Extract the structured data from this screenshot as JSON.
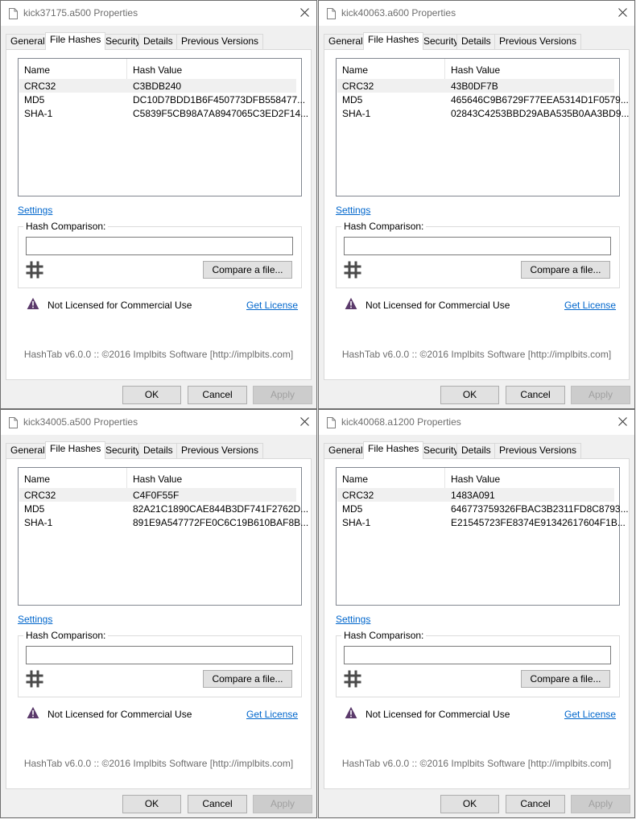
{
  "tabs": [
    "General",
    "File Hashes",
    "Security",
    "Details",
    "Previous Versions"
  ],
  "columns": {
    "name": "Name",
    "hash": "Hash Value"
  },
  "settings_link": "Settings",
  "hash_comparison_label": "Hash Comparison:",
  "hash_input_value": "",
  "compare_button": "Compare a file...",
  "license_warning": "Not Licensed for Commercial Use",
  "get_license_link": "Get License",
  "footer": "HashTab v6.0.0 :: ©2016 Implbits Software [http://implbits.com]",
  "buttons": {
    "ok": "OK",
    "cancel": "Cancel",
    "apply": "Apply"
  },
  "windows": [
    {
      "title": "kick37175.a500 Properties",
      "hashes": [
        {
          "name": "CRC32",
          "value": "C3BDB240"
        },
        {
          "name": "MD5",
          "value": "DC10D7BDD1B6F450773DFB558477..."
        },
        {
          "name": "SHA-1",
          "value": "C5839F5CB98A7A8947065C3ED2F14..."
        }
      ]
    },
    {
      "title": "kick40063.a600 Properties",
      "hashes": [
        {
          "name": "CRC32",
          "value": "43B0DF7B"
        },
        {
          "name": "MD5",
          "value": "465646C9B6729F77EEA5314D1F0579..."
        },
        {
          "name": "SHA-1",
          "value": "02843C4253BBD29ABA535B0AA3BD9..."
        }
      ]
    },
    {
      "title": "kick34005.a500 Properties",
      "hashes": [
        {
          "name": "CRC32",
          "value": "C4F0F55F"
        },
        {
          "name": "MD5",
          "value": "82A21C1890CAE844B3DF741F2762D..."
        },
        {
          "name": "SHA-1",
          "value": "891E9A547772FE0C6C19B610BAF8B..."
        }
      ]
    },
    {
      "title": "kick40068.a1200 Properties",
      "hashes": [
        {
          "name": "CRC32",
          "value": "1483A091"
        },
        {
          "name": "MD5",
          "value": "646773759326FBAC3B2311FD8C8793..."
        },
        {
          "name": "SHA-1",
          "value": "E21545723FE8374E91342617604F1B..."
        }
      ]
    }
  ]
}
